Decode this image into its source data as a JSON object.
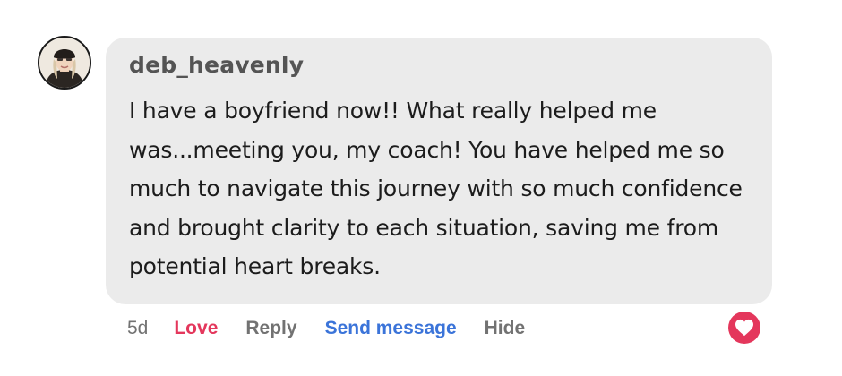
{
  "comment": {
    "author": "deb_heavenly",
    "text": "I have a boyfriend now!! What really helped me was...meeting you, my coach! You have helped me so much to navigate this journey with so much confidence and brought clarity to each situation, saving me from potential heart breaks.",
    "avatar_icon": "user-avatar"
  },
  "actions": {
    "time": "5d",
    "love": "Love",
    "reply": "Reply",
    "send_message": "Send message",
    "hide": "Hide"
  },
  "reaction": {
    "icon": "heart-icon",
    "color": "#e4375c"
  },
  "colors": {
    "bubble": "#ebebeb",
    "love": "#e4375c",
    "link": "#3b74d9",
    "muted": "#727272"
  }
}
